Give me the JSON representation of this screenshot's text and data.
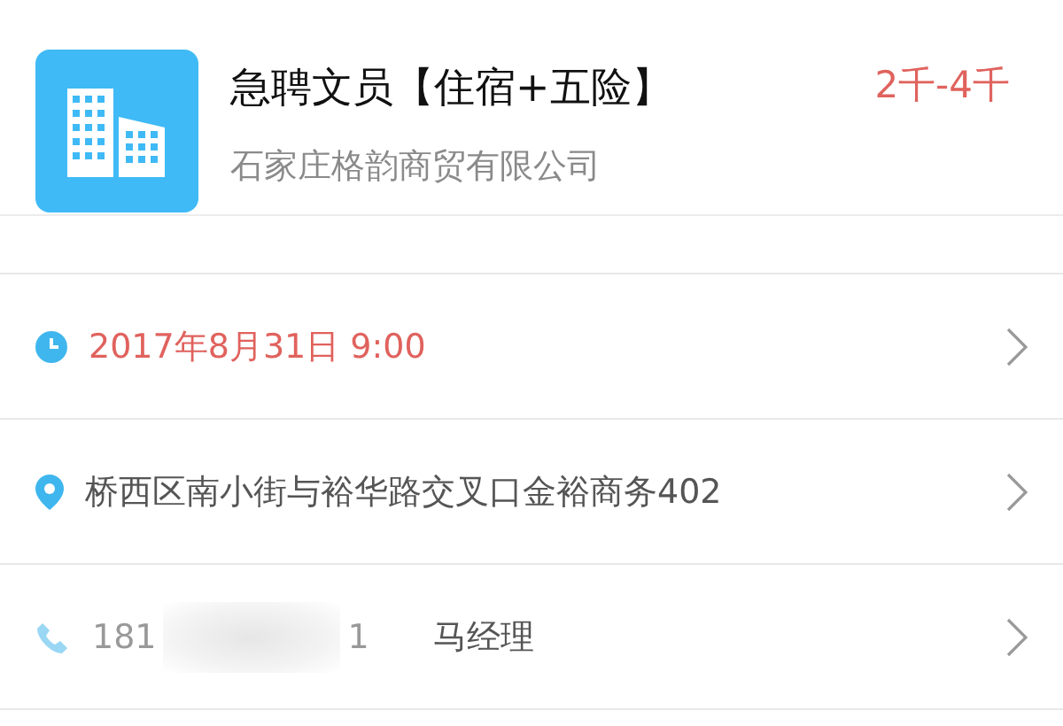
{
  "job": {
    "title": "急聘文员【住宿+五险】",
    "salary": "2千-4千",
    "company": "石家庄格韵商贸有限公司"
  },
  "rows": [
    {
      "kind": "time",
      "text": "2017年8月31日  9:00",
      "color": "#e0625d"
    },
    {
      "kind": "location",
      "text": "桥西区南小街与裕华路交叉口金裕商务402",
      "color": "#555555"
    },
    {
      "kind": "phone",
      "phone_start": "181",
      "phone_end": "1",
      "contact": "马经理",
      "color": "#999999"
    }
  ]
}
